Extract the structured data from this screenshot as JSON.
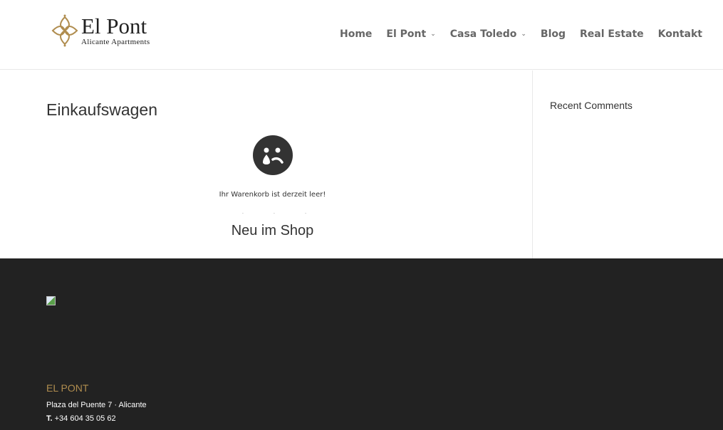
{
  "header": {
    "logo_title": "El Pont",
    "logo_subtitle": "Alicante Apartments",
    "nav": [
      {
        "label": "Home",
        "dropdown": false
      },
      {
        "label": "El Pont",
        "dropdown": true
      },
      {
        "label": "Casa Toledo",
        "dropdown": true
      },
      {
        "label": "Blog",
        "dropdown": false
      },
      {
        "label": "Real Estate",
        "dropdown": false
      },
      {
        "label": "Kontakt",
        "dropdown": false
      }
    ]
  },
  "main": {
    "title": "Einkaufswagen",
    "empty_icon": "sad-face-icon",
    "empty_message": "Ihr Warenkorb ist derzeit leer!",
    "new_in_shop": "Neu im Shop"
  },
  "sidebar": {
    "recent_comments": "Recent Comments"
  },
  "footer": {
    "title": "EL PONT",
    "address": "Plaza del Puente 7 · Alicante",
    "phone_label": "T.",
    "phone": "+34 604 35 05 62"
  },
  "colors": {
    "accent": "#b08d4f",
    "footer_bg": "#222222"
  }
}
